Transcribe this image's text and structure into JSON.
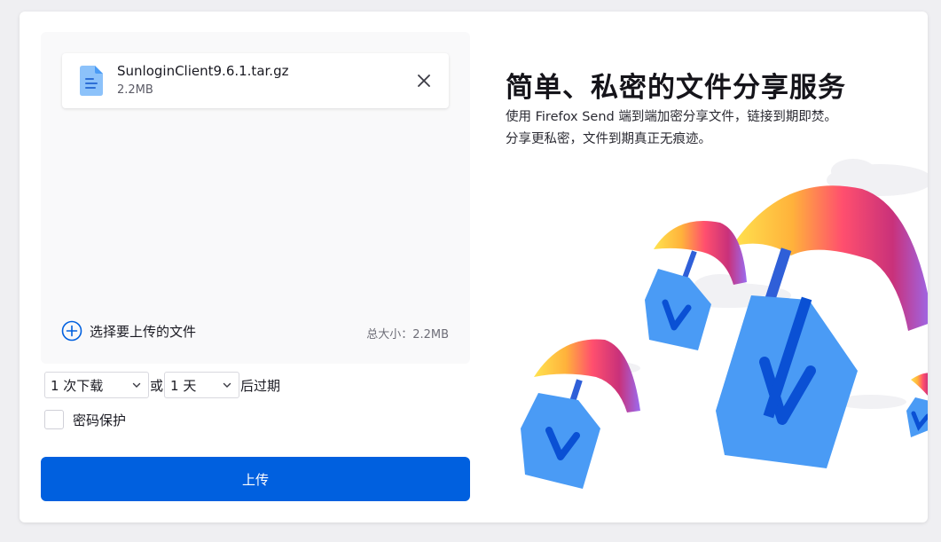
{
  "file": {
    "name": "SunloginClient9.6.1.tar.gz",
    "size": "2.2MB"
  },
  "upload_area": {
    "add_label": "选择要上传的文件",
    "total_size": "总大小：2.2MB"
  },
  "options": {
    "downloads_value": "1 次下载",
    "or_label": "或",
    "days_value": "1 天",
    "expire_suffix": "后过期",
    "password_label": "密码保护"
  },
  "upload_button": "上传",
  "intro": {
    "headline": "简单、私密的文件分享服务",
    "description": "使用 Firefox Send 端到端加密分享文件，链接到期即焚。分享更私密，文件到期真正无痕迹。"
  },
  "colors": {
    "accent": "#0060df",
    "file_icon": "#4a9bf5"
  },
  "icons": {
    "file": "document-icon",
    "close": "close-icon",
    "add": "add-circle-icon",
    "chevron": "chevron-down-icon"
  }
}
